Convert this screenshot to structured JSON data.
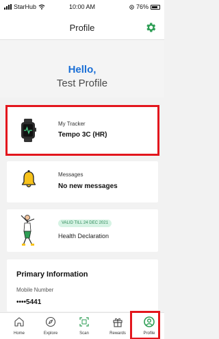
{
  "status_bar": {
    "carrier": "StarHub",
    "time": "10:00 AM",
    "battery": "76%"
  },
  "header": {
    "title": "Profile",
    "settings_icon": "gear-icon"
  },
  "greeting": {
    "hello": "Hello,",
    "name": "Test Profile"
  },
  "tracker": {
    "label": "My Tracker",
    "value": "Tempo 3C (HR)",
    "icon": "smartwatch-icon"
  },
  "messages": {
    "label": "Messages",
    "value": "No new messages",
    "icon": "bell-icon"
  },
  "health": {
    "badge": "VALID TILL 24 DEC 2021",
    "value": "Health Declaration",
    "icon": "person-illustration-icon"
  },
  "primary_info": {
    "heading": "Primary Information",
    "mobile_label": "Mobile Number",
    "mobile_value": "••••5441"
  },
  "tabs": [
    {
      "label": "Home",
      "icon": "home-icon"
    },
    {
      "label": "Explore",
      "icon": "compass-icon"
    },
    {
      "label": "Scan",
      "icon": "scan-icon"
    },
    {
      "label": "Rewards",
      "icon": "gift-icon"
    },
    {
      "label": "Profile",
      "icon": "profile-icon",
      "active": true
    }
  ],
  "colors": {
    "accent_green": "#2e9e55",
    "hello_blue": "#1a6fd6",
    "highlight_red": "#e3161d"
  }
}
